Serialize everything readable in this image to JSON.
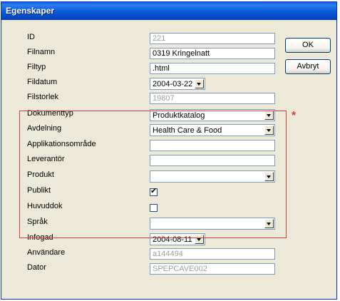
{
  "window": {
    "title": "Egenskaper"
  },
  "buttons": {
    "ok": "OK",
    "cancel": "Avbryt"
  },
  "fields": {
    "id": {
      "label": "ID",
      "value": "221"
    },
    "filnamn": {
      "label": "Filnamn",
      "value": "0319 Kringelnatt"
    },
    "filtyp": {
      "label": "Filtyp",
      "value": ".html"
    },
    "filedatum": {
      "label": "Fildatum",
      "value": "2004-03-22"
    },
    "filstorlek": {
      "label": "Filstorlek",
      "value": "19807"
    },
    "dokumenttyp": {
      "label": "Dokumenttyp",
      "value": "Produktkatalog"
    },
    "avdelning": {
      "label": "Avdelning",
      "value": "Health Care & Food"
    },
    "applikationsomrade": {
      "label": "Applikationsområde",
      "value": ""
    },
    "leverantor": {
      "label": "Leverantör",
      "value": ""
    },
    "produkt": {
      "label": "Produkt",
      "value": ""
    },
    "publikt": {
      "label": "Publikt",
      "checked": true,
      "mark": "✔"
    },
    "huvuddok": {
      "label": "Huvuddok",
      "checked": false
    },
    "sprak": {
      "label": "Språk",
      "value": ""
    },
    "infogad": {
      "label": "Infogad",
      "value": "2004-08-11"
    },
    "anvandare": {
      "label": "Användare",
      "value": "a144494"
    },
    "dator": {
      "label": "Dator",
      "value": "SPEPCAVE002"
    }
  },
  "required_marker": "*",
  "colors": {
    "highlight": "#e03c3c",
    "titlebar": "#0a5fdc",
    "dialog_bg": "#ece9d8"
  }
}
